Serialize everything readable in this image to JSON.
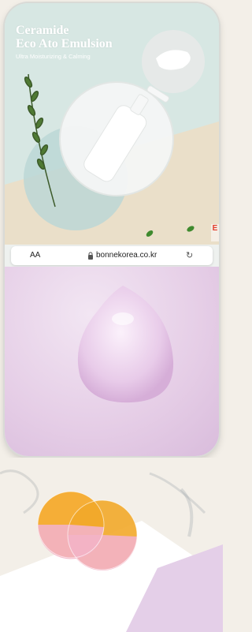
{
  "hero": {
    "title": "Ceramide\nEco Ato Emulsion",
    "subtitle": "Ultra Moisturizing & Calming",
    "brand_letter": "E"
  },
  "browser": {
    "text_size_label": "AA",
    "url": "bonnekorea.co.kr",
    "reload_glyph": "↻"
  },
  "colors": {
    "hero_bg": "#d7e7e3",
    "pink_bg": "#e5cde6",
    "accent_orange": "#f2a92a"
  }
}
